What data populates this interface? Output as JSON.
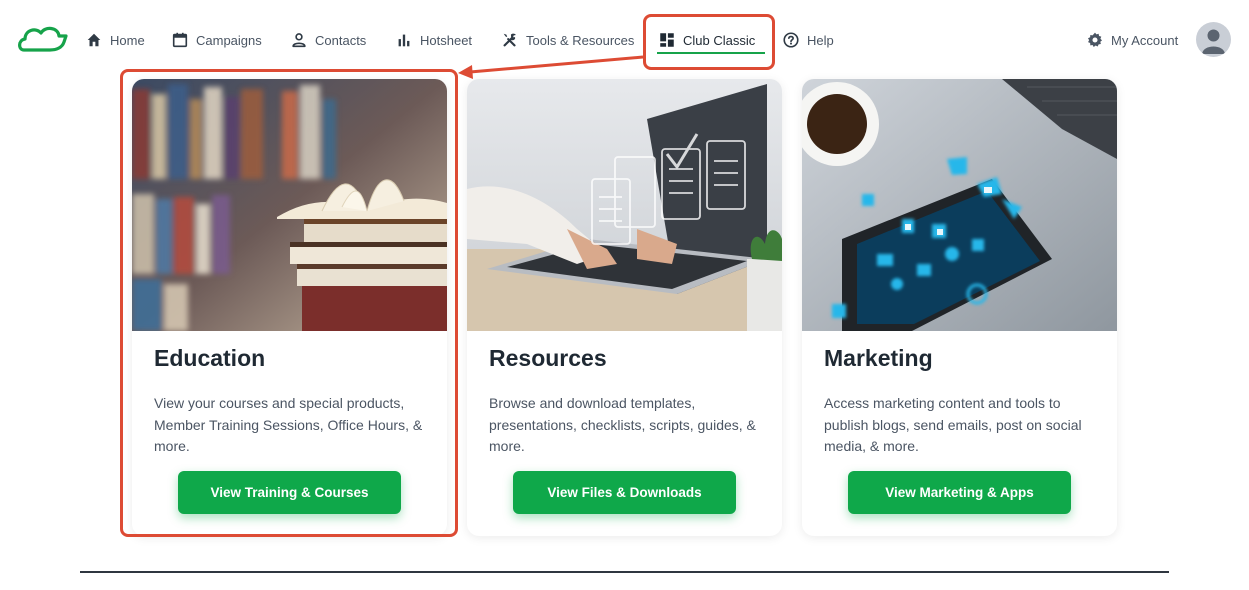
{
  "nav": {
    "items": [
      {
        "label": "Home",
        "icon": "home-icon"
      },
      {
        "label": "Campaigns",
        "icon": "calendar-icon"
      },
      {
        "label": "Contacts",
        "icon": "person-icon"
      },
      {
        "label": "Hotsheet",
        "icon": "bar-chart-icon"
      },
      {
        "label": "Tools & Resources",
        "icon": "tools-icon"
      },
      {
        "label": "Club Classic",
        "icon": "dashboard-icon",
        "active": true
      },
      {
        "label": "Help",
        "icon": "help-icon"
      }
    ],
    "account_label": "My Account",
    "accent_color": "#16a34a"
  },
  "cards": [
    {
      "title": "Education",
      "description": "View your courses and special products, Member Training Sessions, Office Hours, & more.",
      "button_label": "View Training & Courses",
      "image": "books-on-shelf-photo"
    },
    {
      "title": "Resources",
      "description": "Browse and download templates, presentations, checklists, scripts, guides, & more.",
      "button_label": "View Files & Downloads",
      "image": "laptop-checklist-photo"
    },
    {
      "title": "Marketing",
      "description": "Access marketing content and tools to publish blogs, send emails, post on social media, & more.",
      "button_label": "View Marketing & Apps",
      "image": "tablet-social-icons-photo"
    }
  ],
  "colors": {
    "button_green": "#0fa84a",
    "annotation_red": "#dd4b34"
  }
}
